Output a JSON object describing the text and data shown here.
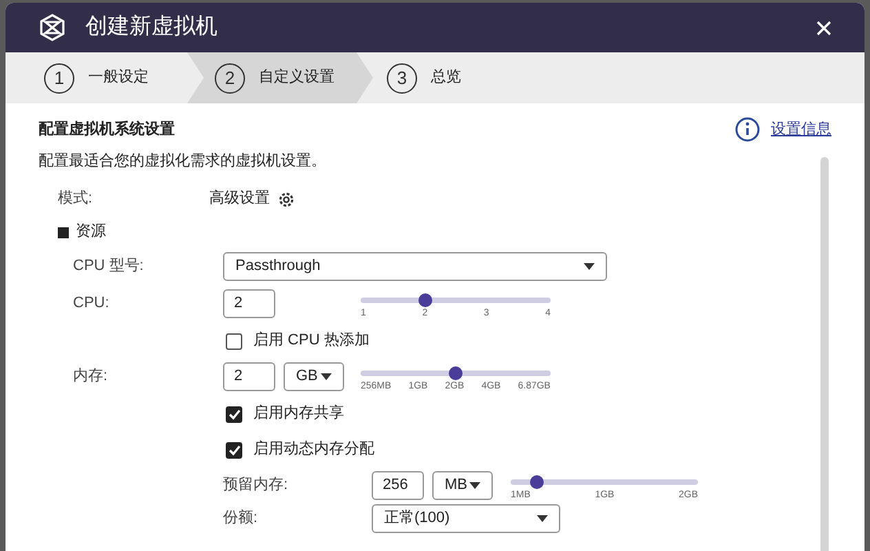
{
  "window": {
    "title": "创建新虚拟机"
  },
  "steps": [
    {
      "number": "1",
      "label": "一般设定",
      "selected": false
    },
    {
      "number": "2",
      "label": "自定义设置",
      "selected": true
    },
    {
      "number": "3",
      "label": "总览",
      "selected": false
    }
  ],
  "section": {
    "title": "配置虚拟机系统设置",
    "description": "配置最适合您的虚拟化需求的虚拟机设置。",
    "info_link": "设置信息"
  },
  "mode": {
    "label": "模式:",
    "value": "高级设置"
  },
  "resources": {
    "title": "资源"
  },
  "cpu_model": {
    "label": "CPU 型号:",
    "value": "Passthrough"
  },
  "cpu": {
    "label": "CPU:",
    "value": "2",
    "level": 0.34,
    "ticks": [
      "1",
      "2",
      "3",
      "4"
    ]
  },
  "cpu_hot_add": {
    "label": "启用 CPU 热添加",
    "checked": false
  },
  "memory": {
    "label": "内存:",
    "value": "2",
    "unit": "GB",
    "level": 0.5,
    "ticks": [
      "256MB",
      "1GB",
      "2GB",
      "4GB",
      "6.87GB"
    ]
  },
  "memory_sharing": {
    "label": "启用内存共享",
    "checked": true
  },
  "dynamic_memory": {
    "label": "启用动态内存分配",
    "checked": true
  },
  "reserved_memory": {
    "label": "预留内存:",
    "value": "256",
    "unit": "MB",
    "level": 0.14,
    "ticks": [
      "1MB",
      "1GB",
      "2GB"
    ]
  },
  "share": {
    "label": "份额:",
    "value": "正常(100)"
  }
}
